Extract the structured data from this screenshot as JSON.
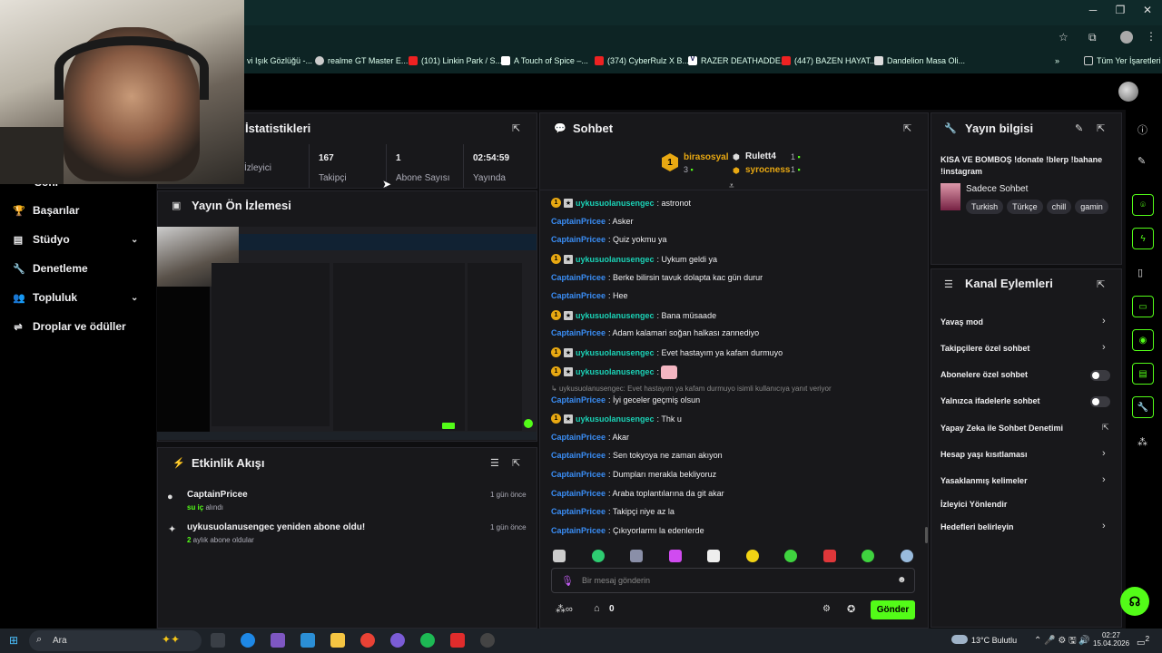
{
  "bookmarks": [
    "vi Işık Gözlüğü -...",
    "realme GT Master E...",
    "(101) Linkin Park / S...",
    "A Touch of Spice –...",
    "(374) CyberRulz X B...",
    "RAZER DEATHADDE...",
    "(447) BAZEN HAYAT...",
    "Dandelion Masa Oli...",
    "Tüm Yer İşaretleri"
  ],
  "nav": {
    "items": [
      "Başarılar",
      "Stüdyo",
      "Denetleme",
      "Topluluk",
      "Droplar ve ödüller"
    ],
    "partial_top": "Sohl"
  },
  "stats": {
    "title": "İstatistikleri",
    "items": [
      {
        "value": "",
        "label": "İzleyici"
      },
      {
        "value": "167",
        "label": "Takipçi"
      },
      {
        "value": "1",
        "label": "Abone Sayısı"
      },
      {
        "value": "02:54:59",
        "label": "Yayında"
      }
    ]
  },
  "preview": {
    "title": "Yayın Ön İzlemesi"
  },
  "activity": {
    "title": "Etkinlik Akışı",
    "events": [
      {
        "user": "CaptainPricee",
        "detail": "su iç",
        "detail_suffix": " alındı",
        "time": "1 gün önce"
      },
      {
        "user": "uykusuolanusengec yeniden abone oldu!",
        "detail": "2",
        "detail_suffix": " aylık abone oldular",
        "time": "1 gün önce"
      }
    ]
  },
  "chat": {
    "title": "Sohbet",
    "leaders": {
      "first": {
        "name": "birasosyal",
        "count": "3"
      },
      "second": {
        "name": "Rulett4",
        "count": "1"
      },
      "third": {
        "name": "syrocness",
        "count": "1"
      }
    },
    "messages": [
      {
        "user": "uykusuolanusengec",
        "text": ": astronot",
        "sub": true
      },
      {
        "user": "CaptainPricee",
        "text": ": Asker",
        "sub": false
      },
      {
        "user": "CaptainPricee",
        "text": ": Quiz yokmu ya",
        "sub": false
      },
      {
        "user": "uykusuolanusengec",
        "text": ": Uykum geldi ya",
        "sub": true
      },
      {
        "user": "CaptainPricee",
        "text": ": Berke bilirsin tavuk dolapta kac gün durur",
        "sub": false
      },
      {
        "user": "CaptainPricee",
        "text": ": Hee",
        "sub": false
      },
      {
        "user": "uykusuolanusengec",
        "text": ": Bana müsaade",
        "sub": true
      },
      {
        "user": "CaptainPricee",
        "text": ": Adam kalamari soğan halkası zannediyo",
        "sub": false
      },
      {
        "user": "uykusuolanusengec",
        "text": ": Evet hastayım ya kafam durmuyo",
        "sub": true
      },
      {
        "user": "uykusuolanusengec",
        "text": ":",
        "sub": true
      },
      {
        "user": "CaptainPricee",
        "text": ": İyi geceler geçmiş olsun",
        "sub": false
      },
      {
        "user": "uykusuolanusengec",
        "text": ": Thk u",
        "sub": true
      },
      {
        "user": "CaptainPricee",
        "text": ": Akar",
        "sub": false
      },
      {
        "user": "CaptainPricee",
        "text": ": Sen tokyoya ne zaman akıyon",
        "sub": false
      },
      {
        "user": "CaptainPricee",
        "text": ": Dumpları merakla bekliyoruz",
        "sub": false
      },
      {
        "user": "CaptainPricee",
        "text": ": Araba toplantılarına da git akar",
        "sub": false
      },
      {
        "user": "CaptainPricee",
        "text": ": Takipçi niye az la",
        "sub": false
      },
      {
        "user": "CaptainPricee",
        "text": ": Çıkıyorlarmı la edenlerde",
        "sub": false
      }
    ],
    "reply_text": "uykusuolanusengec: Evet hastayım ya kafam durmuyo isimli kullanıcıya yanıt veriyor",
    "input_placeholder": "Bir mesaj gönderin",
    "points": "0",
    "send_label": "Gönder"
  },
  "info": {
    "title": "Yayın bilgisi",
    "stream_title": "KISA VE BOMBOŞ !donate !blerp !bahane !instagram",
    "category": "Sadece Sohbet",
    "tags": [
      "Turkish",
      "Türkçe",
      "chill",
      "gamin"
    ]
  },
  "actions": {
    "title": "Kanal Eylemleri",
    "items": [
      "Yavaş mod",
      "Takipçilere özel sohbet",
      "Abonelere özel sohbet",
      "Yalnızca ifadelerle sohbet",
      "Yapay Zeka ile Sohbet Denetimi",
      "Hesap yaşı kısıtlaması",
      "Yasaklanmış kelimeler",
      "İzleyici Yönlendir",
      "Hedefleri belirleyin"
    ]
  },
  "taskbar": {
    "search": "Ara",
    "weather": "13°C Bulutlu",
    "time": "02:27",
    "date": "15.04.2026",
    "notif": "2"
  },
  "colors": {
    "accent": "#53fc18",
    "sub_user": "#1bd2b6",
    "user": "#3a8ef6"
  }
}
